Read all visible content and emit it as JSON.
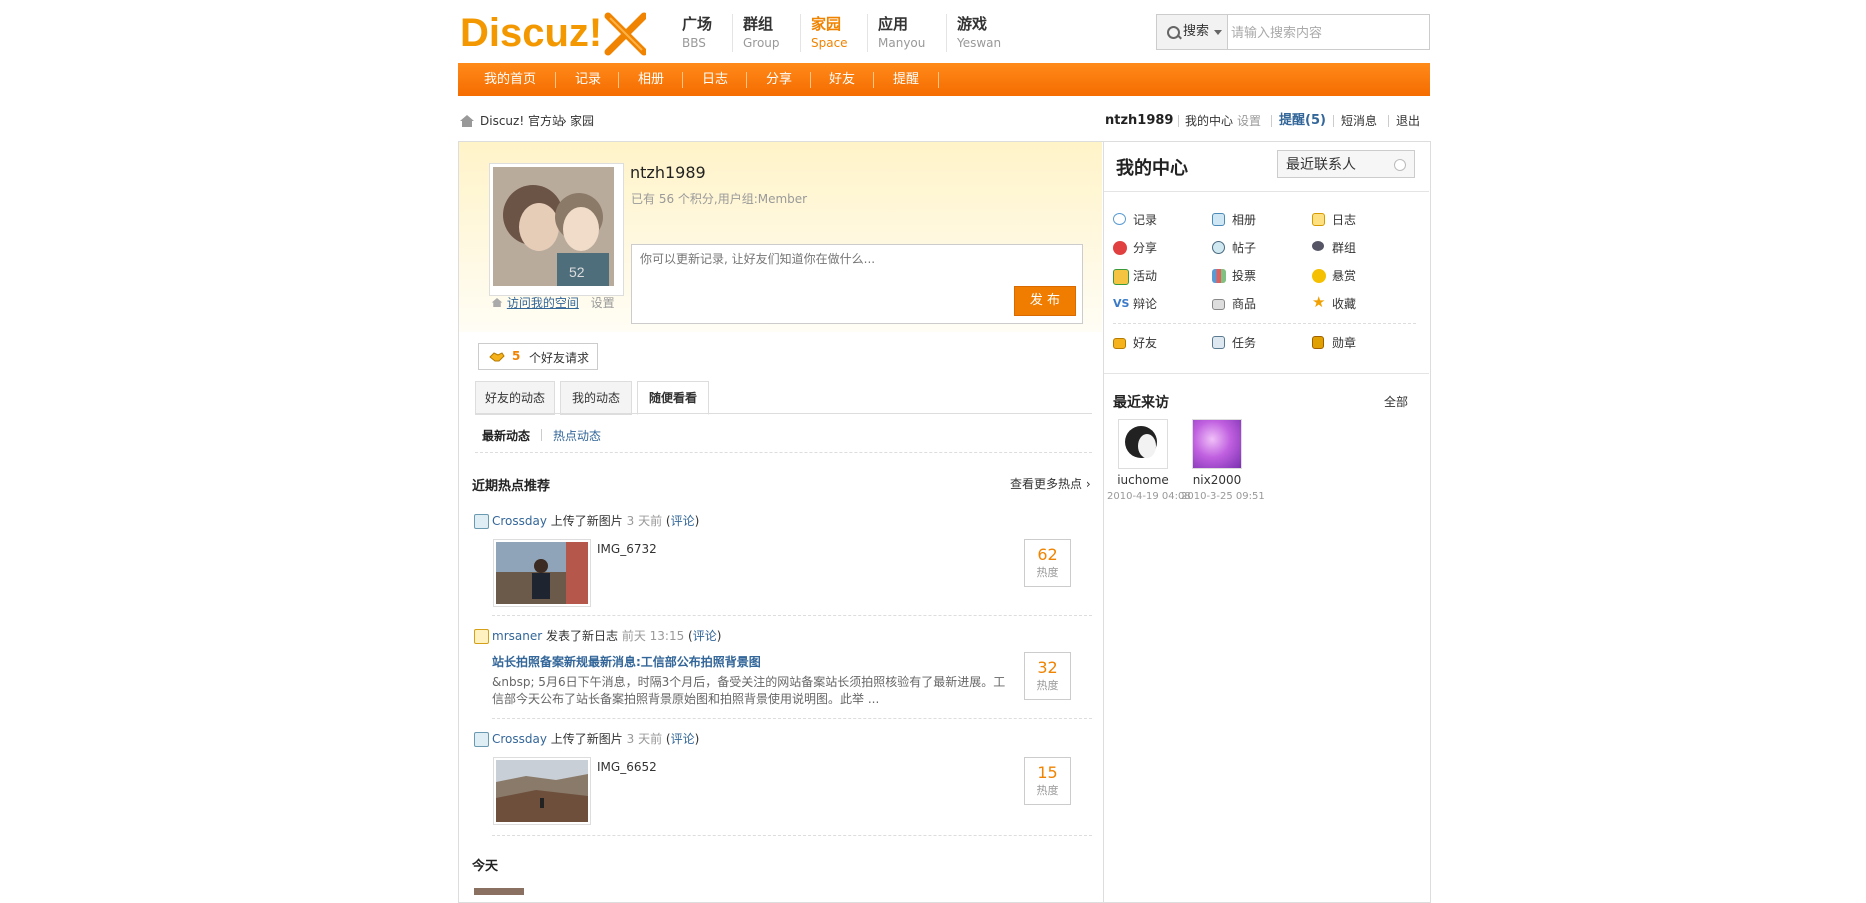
{
  "header": {
    "logo_text": "Discuz!",
    "nav": [
      {
        "cn": "广场",
        "en": "BBS"
      },
      {
        "cn": "群组",
        "en": "Group"
      },
      {
        "cn": "家园",
        "en": "Space"
      },
      {
        "cn": "应用",
        "en": "Manyou"
      },
      {
        "cn": "游戏",
        "en": "Yeswan"
      }
    ],
    "search": {
      "button_label": "搜索",
      "placeholder": "请输入搜索内容"
    }
  },
  "subnav": [
    "我的首页",
    "记录",
    "相册",
    "日志",
    "分享",
    "好友",
    "提醒"
  ],
  "breadcrumb": {
    "site": "Discuz! 官方站",
    "sep": "›",
    "current": "家园"
  },
  "userbar": {
    "username": "ntzh1989",
    "my_center": "我的中心",
    "settings": "设置",
    "remind": "提醒(5)",
    "messages": "短消息",
    "logout": "退出"
  },
  "profile": {
    "username": "ntzh1989",
    "stats": "已有 56 个积分,用户组:Member",
    "status_placeholder": "你可以更新记录, 让好友们知道你在做什么...",
    "publish_label": "发 布",
    "visit_space": "访问我的空间",
    "settings": "设置"
  },
  "friend_requests": {
    "count": "5",
    "label": "个好友请求"
  },
  "tabs": [
    "好友的动态",
    "我的动态",
    "随便看看"
  ],
  "subtabs": {
    "latest": "最新动态",
    "hot": "热点动态"
  },
  "hot_section": {
    "title": "近期热点推荐",
    "more": "查看更多热点 ›"
  },
  "feeds": [
    {
      "user": "Crossday",
      "action": "上传了新图片",
      "time": "3 天前",
      "comment": "评论",
      "title": "IMG_6732",
      "heat": "62",
      "heat_label": "热度"
    },
    {
      "user": "mrsaner",
      "action": "发表了新日志",
      "time": "前天 13:15",
      "comment": "评论",
      "title": "站长拍照备案新规最新消息:工信部公布拍照背景图",
      "body1": "&nbsp;     5月6日下午消息，时隔3个月后，备受关注的网站备案站长须拍照核验有了最新进展。工",
      "body2": "信部今天公布了站长备案拍照背景原始图和拍照背景使用说明图。此举 ...",
      "heat": "32",
      "heat_label": "热度"
    },
    {
      "user": "Crossday",
      "action": "上传了新图片",
      "time": "3 天前",
      "comment": "评论",
      "title": "IMG_6652",
      "heat": "15",
      "heat_label": "热度"
    }
  ],
  "today_title": "今天",
  "right": {
    "title": "我的中心",
    "recent_contacts": "最近联系人",
    "apps": [
      "记录",
      "相册",
      "日志",
      "分享",
      "帖子",
      "群组",
      "活动",
      "投票",
      "悬赏",
      "辩论",
      "商品",
      "收藏",
      "好友",
      "任务",
      "勋章"
    ],
    "vs_glyph": "VS",
    "visitors_title": "最近来访",
    "visitors_all": "全部",
    "visitors": [
      {
        "name": "iuchome",
        "time": "2010-4-19 04:08"
      },
      {
        "name": "nix2000",
        "time": "2010-3-25 09:51"
      }
    ]
  },
  "colors": {
    "brand_orange": "#f56c00",
    "link_blue": "#336699",
    "heat_orange": "#f08300"
  }
}
